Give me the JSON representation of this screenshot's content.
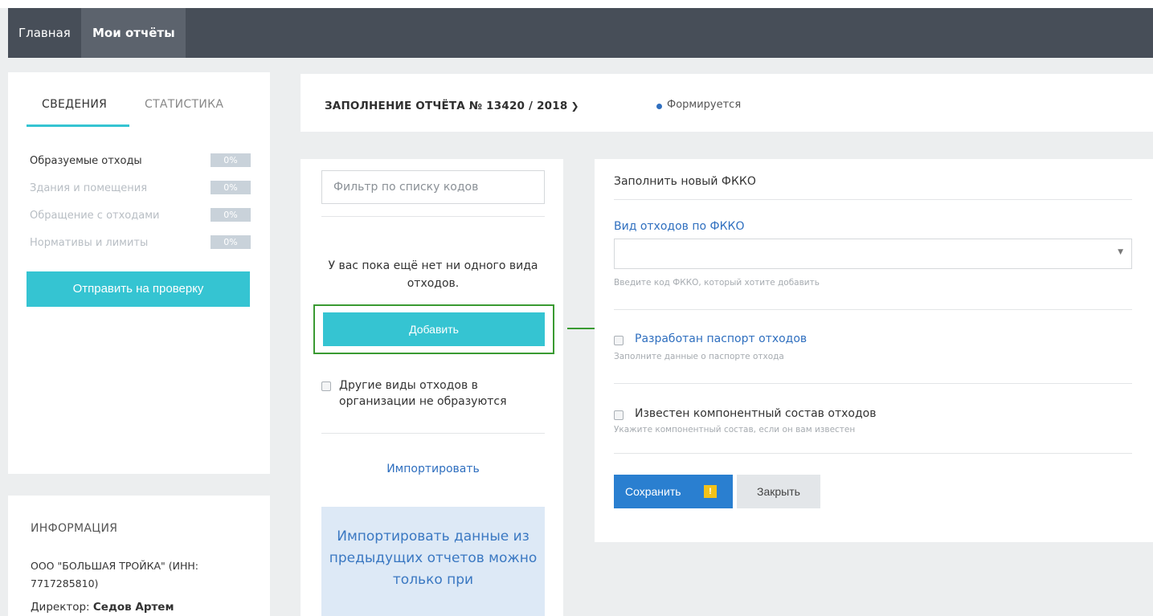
{
  "nav": {
    "home": "Главная",
    "reports": "Мои отчёты"
  },
  "sidebar": {
    "tabs": [
      "СВЕДЕНИЯ",
      "СТАТИСТИКА"
    ],
    "items": [
      {
        "label": "Образуемые отходы",
        "percent": "0%"
      },
      {
        "label": "Здания и помещения",
        "percent": "0%"
      },
      {
        "label": "Обращение с отходами",
        "percent": "0%"
      },
      {
        "label": "Нормативы и лимиты",
        "percent": "0%"
      }
    ],
    "send_button": "Отправить на проверку"
  },
  "info": {
    "title": "ИНФОРМАЦИЯ",
    "org": "ООО \"БОЛЬШАЯ ТРОЙКА\" (ИНН: 7717285810)",
    "director_label": "Директор:",
    "director_name": "Седов Артем"
  },
  "header": {
    "report_title": "ЗАПОЛНЕНИЕ ОТЧЁТА № 13420 / 2018",
    "status": "Формируется"
  },
  "middle": {
    "filter_placeholder": "Фильтр по списку кодов",
    "empty_text": "У вас пока ещё нет ни одного вида отходов.",
    "add_button": "Добавить",
    "other_checkbox_label": "Другие виды отходов в организации не образуются",
    "import_link": "Импортировать",
    "import_note": "Импортировать данные из предыдущих отчетов можно только при"
  },
  "right": {
    "title": "Заполнить новый ФККО",
    "vid_label": "Вид отходов по ФККО",
    "select_value": "",
    "select_hint": "Введите код ФККО, который хотите добавить",
    "passport_label": "Разработан паспорт отходов",
    "passport_sub": "Заполните данные о паспорте отхода",
    "composition_label": "Известен компонентный состав отходов",
    "composition_sub": "Укажите компонентный состав, если он вам известен",
    "save_button": "Сохранить",
    "warn_mark": "!",
    "close_button": "Закрыть"
  },
  "colors": {
    "accent": "#35c4d2",
    "primary": "#2a7fd0",
    "navbar": "#474e58",
    "highlight_frame": "#3a9a32"
  }
}
